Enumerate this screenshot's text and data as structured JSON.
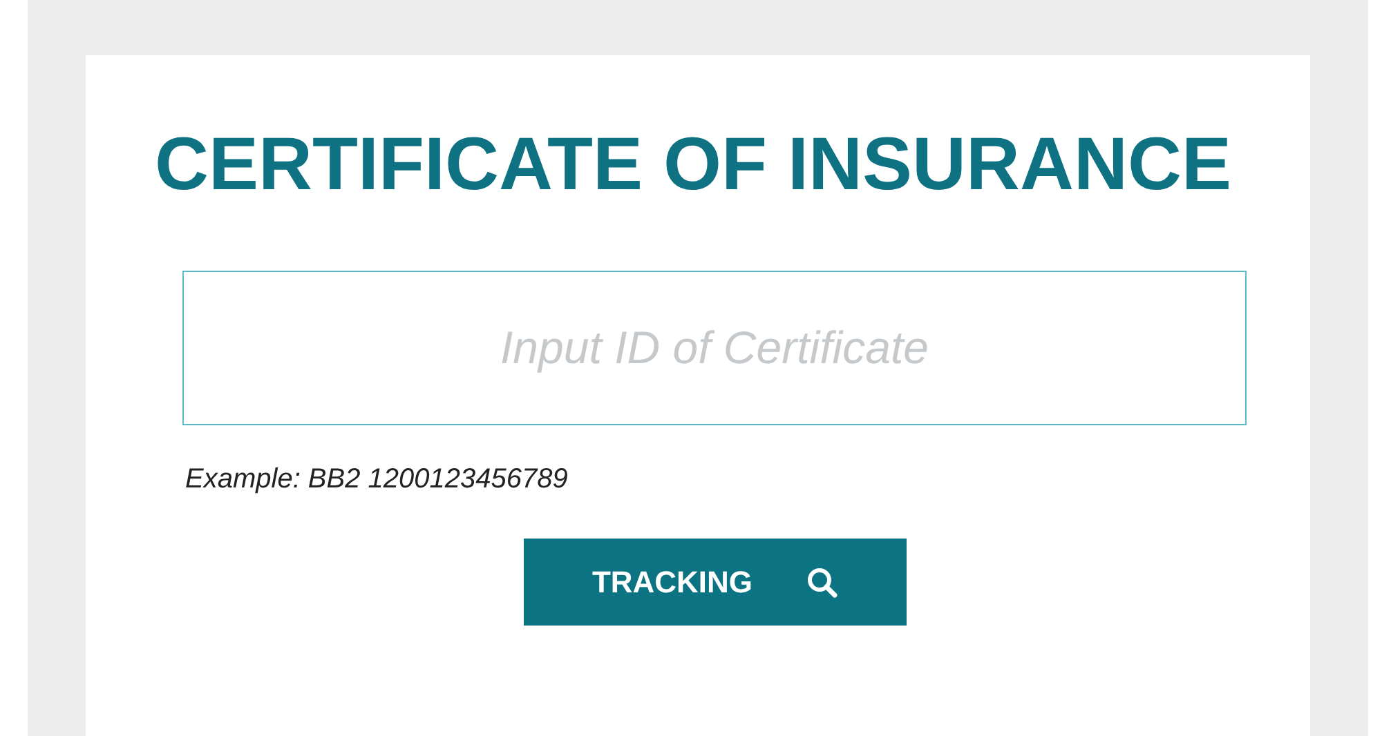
{
  "title": "CERTIFICATE OF INSURANCE",
  "search": {
    "placeholder": "Input ID of Certificate"
  },
  "example": "Example: BB2 1200123456789",
  "button": {
    "label": "TRACKING"
  }
}
